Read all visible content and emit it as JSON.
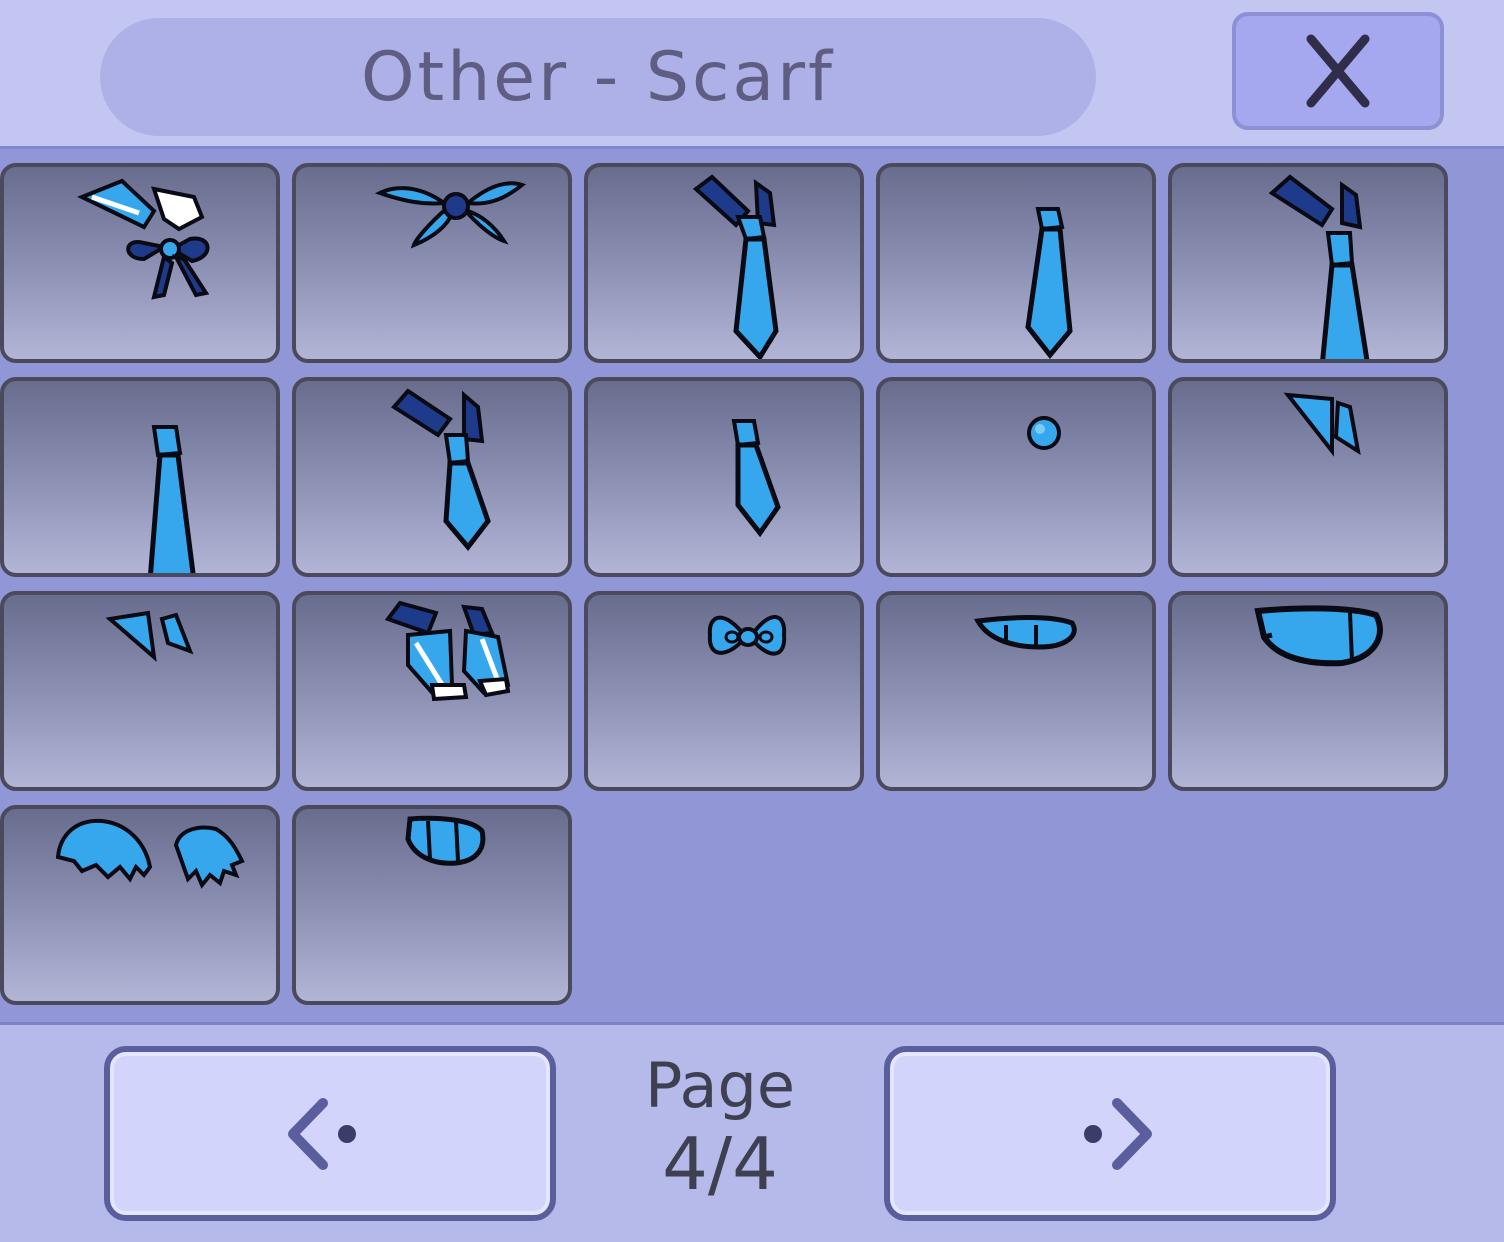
{
  "header": {
    "title": "Other - Scarf",
    "close_label": "X"
  },
  "grid": {
    "items": [
      {
        "icon": "sailor-scarf-icon"
      },
      {
        "icon": "flower-scarf-icon"
      },
      {
        "icon": "collar-necktie-icon"
      },
      {
        "icon": "necktie-icon"
      },
      {
        "icon": "collar-long-necktie-icon"
      },
      {
        "icon": "long-necktie-icon"
      },
      {
        "icon": "collar-short-necktie-icon"
      },
      {
        "icon": "short-necktie-icon"
      },
      {
        "icon": "button-icon"
      },
      {
        "icon": "collar-flap-icon"
      },
      {
        "icon": "small-collar-icon"
      },
      {
        "icon": "sailor-bow-icon"
      },
      {
        "icon": "bowtie-icon"
      },
      {
        "icon": "thin-band-scarf-icon"
      },
      {
        "icon": "wide-band-scarf-icon"
      },
      {
        "icon": "fur-collar-icon"
      },
      {
        "icon": "small-band-scarf-icon"
      }
    ]
  },
  "footer": {
    "page_word": "Page",
    "page_number": "4/4"
  },
  "colors": {
    "accent_blue": "#36a7ec",
    "dark_blue": "#1e3a8a",
    "outline": "#0a0a14"
  }
}
